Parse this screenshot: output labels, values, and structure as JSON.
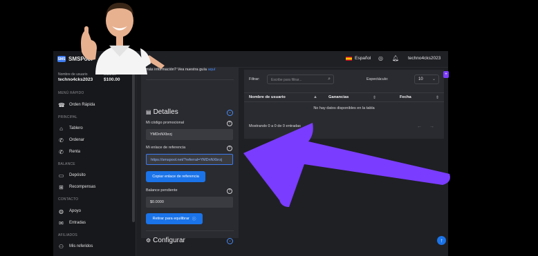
{
  "app": {
    "brand": "SMSPool"
  },
  "user": {
    "username_label": "Nombre de usuario",
    "username": "techno4cks2023",
    "balance_label": "Balance",
    "balance": "$100.00"
  },
  "sidebar": {
    "sections": [
      {
        "title": "MENÚ RÁPIDO",
        "items": [
          {
            "label": "Orden Rápida",
            "icon": "phone-icon"
          }
        ]
      },
      {
        "title": "PRINCIPAL",
        "items": [
          {
            "label": "Tablero",
            "icon": "home-icon"
          },
          {
            "label": "Ordenar",
            "icon": "phone-order-icon"
          },
          {
            "label": "Renta",
            "icon": "phone-rent-icon"
          }
        ]
      },
      {
        "title": "BALANCE",
        "items": [
          {
            "label": "Depósito",
            "icon": "card-icon"
          },
          {
            "label": "Recompensas",
            "icon": "gift-icon"
          }
        ]
      },
      {
        "title": "CONTACTO",
        "items": [
          {
            "label": "Apoyo",
            "icon": "globe-icon"
          },
          {
            "label": "Entradas",
            "icon": "mail-icon"
          }
        ]
      },
      {
        "title": "AFILIADOS",
        "items": [
          {
            "label": "Mis referidos",
            "icon": "users-icon"
          }
        ]
      }
    ]
  },
  "topbar": {
    "language": "Español",
    "username": "techno4cks2023"
  },
  "details": {
    "intro_text": "más información? Vea nuestra guía ",
    "intro_link": "aquí",
    "title": "Detalles",
    "promo_label": "Mi código promocional",
    "promo_value": "YMDnNXbrzj",
    "ref_label": "Mi enlace de referencia",
    "ref_value": "https://smspool.net/?referral=YMDnNXbrzj",
    "copy_button": "Copiar enlace de referencia",
    "pending_label": "Balance pendiente",
    "pending_value": "$0.0000",
    "withdraw_button": "Retirar para equilibrar",
    "config_title": "Configurar"
  },
  "table": {
    "filter_label": "Filtrar:",
    "filter_placeholder": "Escribe para filtrar...",
    "length_label": "Espectáculo:",
    "length_value": "10",
    "columns": [
      "Nombre de usuario",
      "Ganancias",
      "Fecha"
    ],
    "empty_text": "No hay datos disponibles en la tabla",
    "info_text": "Mostrando 0 a 0 de 0 entradas",
    "prev": "←",
    "next": "→"
  },
  "colors": {
    "accent": "#1a73e8",
    "arrow": "#7a3cff"
  }
}
